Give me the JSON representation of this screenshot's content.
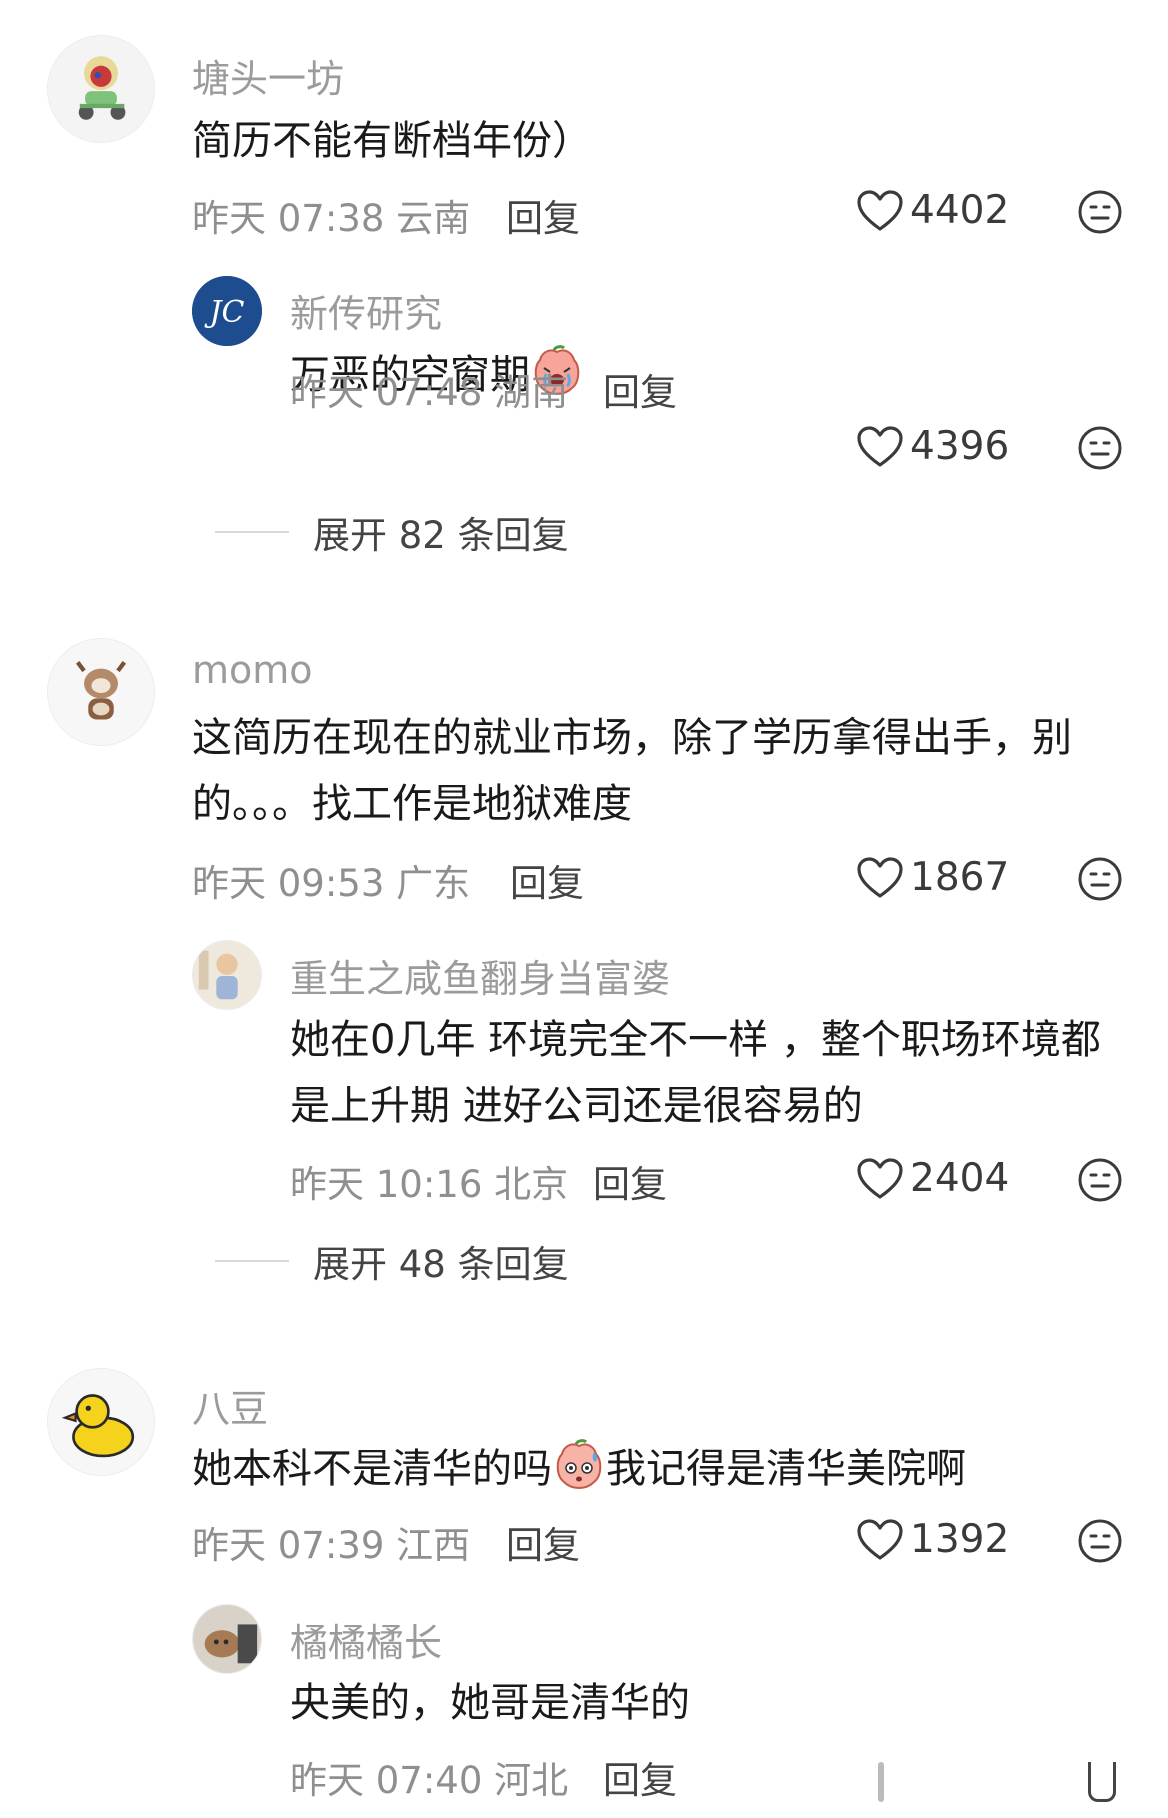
{
  "comments": [
    {
      "username": "塘头一坊",
      "text": "简历不能有断档年份）",
      "time": "昨天 07:38",
      "location": "云南",
      "reply": "回复",
      "likes": "4402",
      "replies": [
        {
          "username": "新传研究",
          "text": "万恶的空窗期",
          "time": "昨天 07:48",
          "location": "湖南",
          "reply": "回复",
          "likes": "4396"
        }
      ],
      "expand": "展开 82 条回复"
    },
    {
      "username": "momo",
      "text": "这简历在现在的就业市场，除了学历拿得出手，别的。。。找工作是地狱难度",
      "time": "昨天 09:53",
      "location": "广东",
      "reply": "回复",
      "likes": "1867",
      "replies": [
        {
          "username": "重生之咸鱼翻身当富婆",
          "text": "她在0几年 环境完全不一样 ，整个职场环境都是上升期 进好公司还是很容易的",
          "time": "昨天 10:16",
          "location": "北京",
          "reply": "回复",
          "likes": "2404"
        }
      ],
      "expand": "展开 48 条回复"
    },
    {
      "username": "八豆",
      "text_before": "她本科不是清华的吗",
      "text_after": "我记得是清华美院啊",
      "time": "昨天 07:39",
      "location": "江西",
      "reply": "回复",
      "likes": "1392",
      "replies": [
        {
          "username": "橘橘橘长",
          "text": "央美的，她哥是清华的",
          "time": "昨天 07:40",
          "location": "河北",
          "reply": "回复"
        }
      ]
    }
  ],
  "icons": {
    "like": "heart-outline-icon",
    "dislike": "neutral-face-icon",
    "avatar_jc_text": "JC"
  },
  "colors": {
    "username": "#9b9b9b",
    "text": "#1a1a1a",
    "meta": "#8f8f8f"
  }
}
